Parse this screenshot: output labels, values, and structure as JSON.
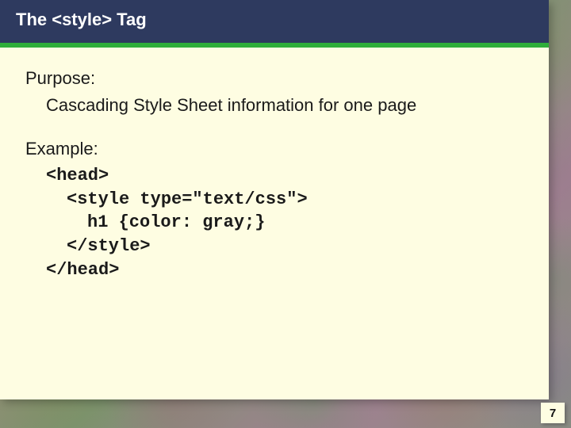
{
  "slide": {
    "title": "The <style> Tag",
    "purpose_label": "Purpose:",
    "purpose_text": "Cascading Style Sheet information for one page",
    "example_label": "Example:",
    "code": {
      "l1": "<head>",
      "l2": "<style type=\"text/css\">",
      "l3": "h1 {color: gray;}",
      "l4": "</style>",
      "l5": "</head>"
    },
    "page_number": "7"
  }
}
